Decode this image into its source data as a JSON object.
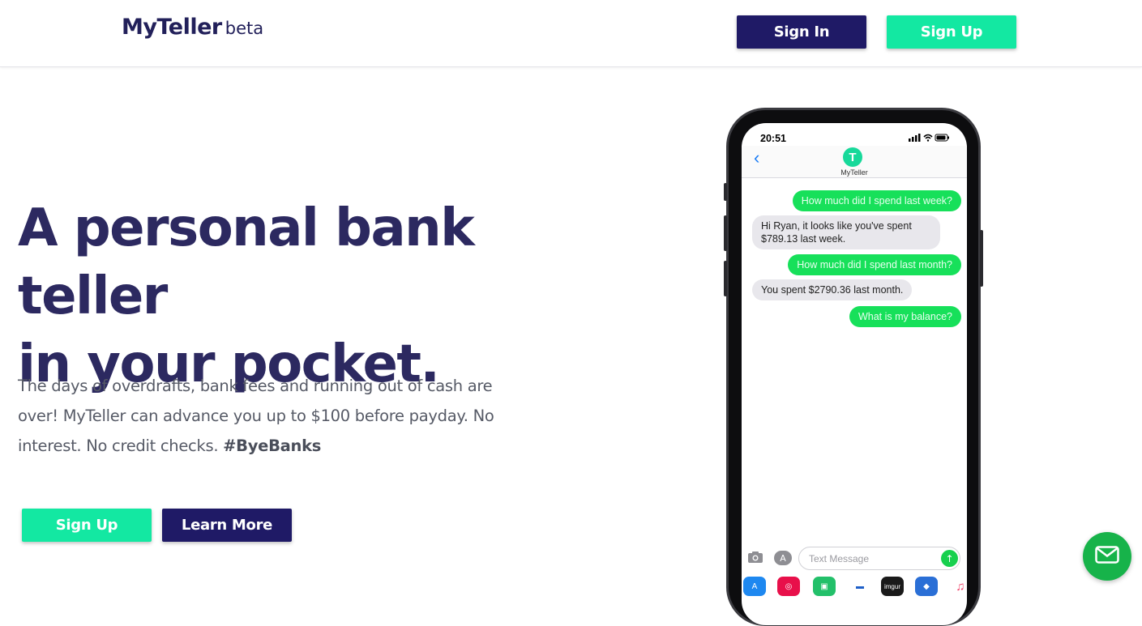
{
  "nav": {
    "brand_name": "MyTeller",
    "brand_tag": "beta",
    "signin_label": "Sign In",
    "signup_label": "Sign Up"
  },
  "hero": {
    "headline_line1": "A personal bank teller",
    "headline_line2": "in your pocket.",
    "desc_text": "The days of overdrafts, bank fees and running out of cash are over! MyTeller can advance you up to $100 before payday. No interest. No credit checks.",
    "desc_hashtag": "#ByeBanks",
    "signup_label": "Sign Up",
    "learn_label": "Learn More"
  },
  "phone": {
    "time": "20:51",
    "contact_initial": "T",
    "contact_name": "MyTeller",
    "messages": [
      {
        "dir": "out",
        "text": "How much did I spend last week?"
      },
      {
        "dir": "in",
        "text": "Hi Ryan, it looks like you've spent $789.13 last week."
      },
      {
        "dir": "out",
        "text": "How much did I spend last month?"
      },
      {
        "dir": "in",
        "text": "You spent $2790.36 last month."
      },
      {
        "dir": "out",
        "text": "What is my balance?"
      }
    ],
    "input_placeholder": "Text Message",
    "apps": [
      "app-store",
      "search-globe",
      "green-shield",
      "car",
      "imgur",
      "news",
      "music"
    ],
    "app_imgur_label": "imgur"
  },
  "colors": {
    "primary_dark": "#1f1a66",
    "primary_green": "#13e8a2",
    "headline": "#2c2960",
    "imessage_green": "#17e05a",
    "mail_fab": "#17b34a"
  },
  "icons": {
    "mail_fab": "mail-icon"
  }
}
